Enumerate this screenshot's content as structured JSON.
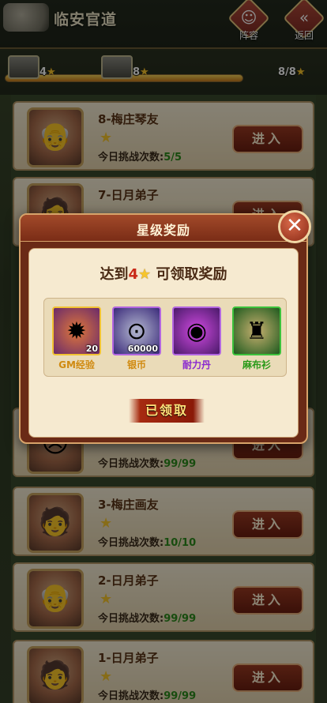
{
  "header": {
    "title": "临安官道",
    "lineup_label": "阵容",
    "back_label": "返回"
  },
  "progress": {
    "milestone_1": "4",
    "milestone_2": "8",
    "total": "8/8",
    "fill_fraction": 1.0
  },
  "stages": [
    {
      "title": "8-梅庄琴友",
      "attempts_label": "今日挑战次数:",
      "attempts": "5/5",
      "enter": "进入"
    },
    {
      "title": "7-日月弟子",
      "attempts_label": "今日挑战次数:",
      "attempts": "",
      "enter": "进入"
    },
    {
      "title": "",
      "attempts_label": "今日挑战次数:",
      "attempts": "99/99",
      "enter": "进入"
    },
    {
      "title": "3-梅庄画友",
      "attempts_label": "今日挑战次数:",
      "attempts": "10/10",
      "enter": "进入"
    },
    {
      "title": "2-日月弟子",
      "attempts_label": "今日挑战次数:",
      "attempts": "99/99",
      "enter": "进入"
    },
    {
      "title": "1-日月弟子",
      "attempts_label": "今日挑战次数:",
      "attempts": "99/99",
      "enter": "进入"
    }
  ],
  "modal": {
    "title": "星级奖励",
    "req_prefix": "达到",
    "req_count": "4",
    "req_suffix": "可领取奖励",
    "rewards": [
      {
        "name": "GM经验",
        "qty": "20",
        "icon": "gm-exp-orb-icon"
      },
      {
        "name": "银币",
        "qty": "60000",
        "icon": "silver-coin-icon"
      },
      {
        "name": "耐力丹",
        "qty": "",
        "icon": "stamina-pill-icon"
      },
      {
        "name": "麻布衫",
        "qty": "",
        "icon": "linen-robe-icon"
      }
    ],
    "status": "已领取"
  },
  "colors": {
    "star": "#f6c52c",
    "attempts_count": "#2c8a1c",
    "req_number": "#c92a18"
  }
}
